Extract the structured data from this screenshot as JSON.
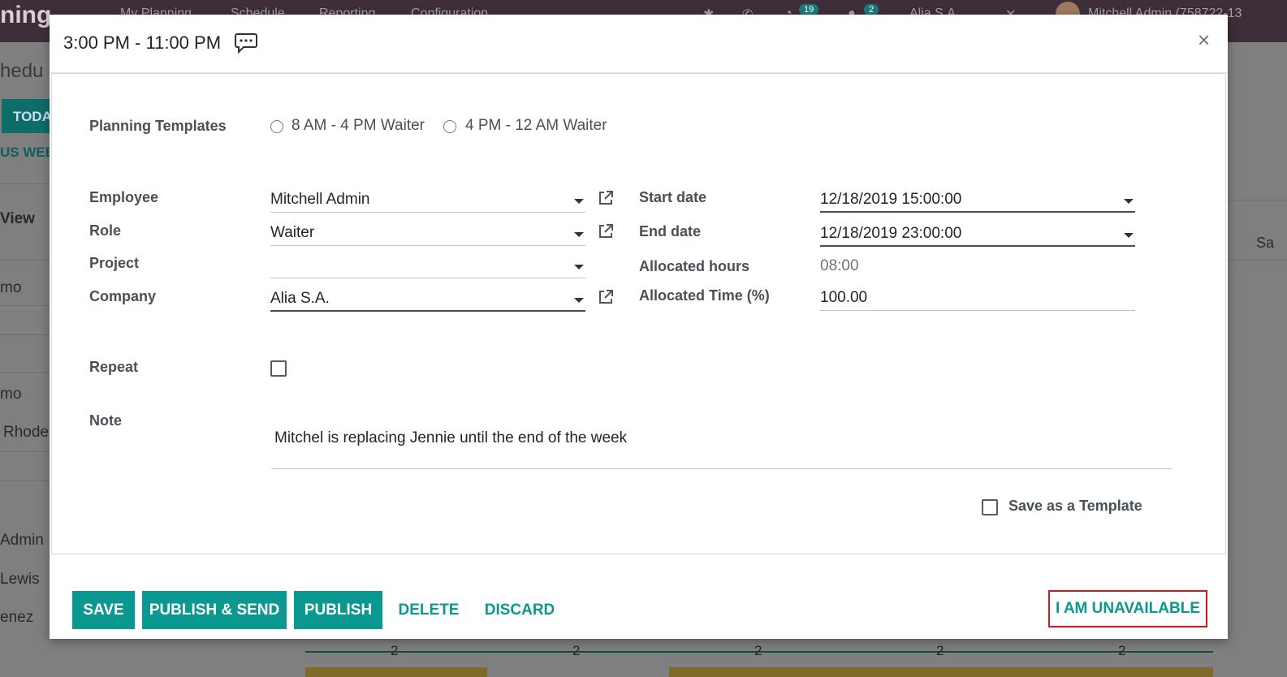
{
  "background": {
    "brand": "ning",
    "menu": [
      "My Planning",
      "Schedule",
      "Reporting",
      "Configuration"
    ],
    "badges": [
      "19",
      "2"
    ],
    "company_switcher": "Alia S.A.",
    "user": "Mitchell Admin (758722-13",
    "breadcrumb": "hedu",
    "today_label": "TODA",
    "prev_week": "US WEE",
    "view_label": "View",
    "sat_label": "Sa",
    "rows": [
      "mo",
      "mo",
      "Rhode",
      "Admin",
      "Lewis",
      "enez"
    ],
    "timeline_counts": [
      "2",
      "2",
      "2",
      "2",
      "2"
    ]
  },
  "modal": {
    "title": "3:00 PM - 11:00 PM",
    "close_label": "×",
    "templates": {
      "label": "Planning Templates",
      "options": [
        "8 AM - 4 PM Waiter",
        "4 PM - 12 AM Waiter"
      ]
    },
    "left": {
      "employee": {
        "label": "Employee",
        "value": "Mitchell Admin"
      },
      "role": {
        "label": "Role",
        "value": "Waiter"
      },
      "project": {
        "label": "Project",
        "value": ""
      },
      "company": {
        "label": "Company",
        "value": "Alia S.A."
      }
    },
    "right": {
      "start_date": {
        "label": "Start date",
        "value": "12/18/2019 15:00:00"
      },
      "end_date": {
        "label": "End date",
        "value": "12/18/2019 23:00:00"
      },
      "allocated_hours": {
        "label": "Allocated hours",
        "value": "08:00"
      },
      "allocated_time": {
        "label": "Allocated Time (%)",
        "value": "100.00"
      }
    },
    "repeat": {
      "label": "Repeat"
    },
    "note": {
      "label": "Note",
      "value": "Mitchel is replacing Jennie until the end of the week"
    },
    "save_template": {
      "label": "Save as a Template"
    },
    "buttons": {
      "save": "SAVE",
      "publish_send": "PUBLISH & SEND",
      "publish": "PUBLISH",
      "delete": "DELETE",
      "discard": "DISCARD",
      "unavailable": "I AM UNAVAILABLE"
    }
  },
  "colors": {
    "primary": "#0b9891",
    "highlight_border": "#d4141e",
    "topbar": "#3d2e3a"
  }
}
